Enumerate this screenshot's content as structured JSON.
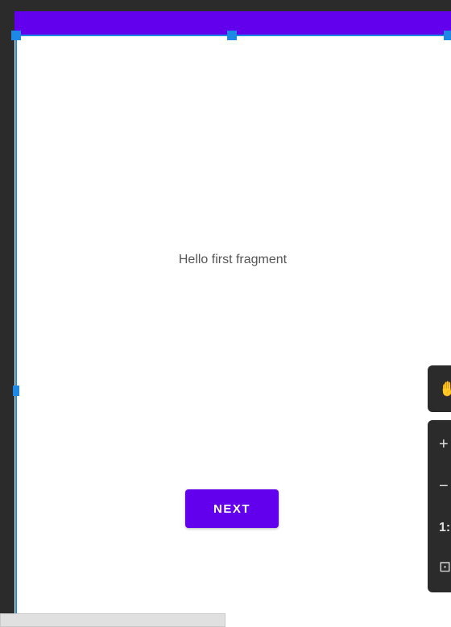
{
  "canvas": {
    "hello_text": "Hello first fragment",
    "next_label": "NEXT"
  },
  "tools": {
    "pan_icon": "hand-icon",
    "zoom_in_symbol": "+",
    "zoom_out_symbol": "−",
    "zoom_level_partial": "1:",
    "fit_symbol": "⊡"
  },
  "colors": {
    "primary": "#6200ee",
    "selection": "#1e88e5",
    "ide_background": "#2b2b2b"
  }
}
